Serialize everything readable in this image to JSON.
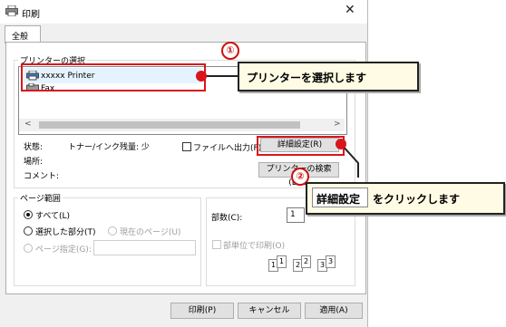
{
  "window": {
    "title": "印刷"
  },
  "tabs": [
    {
      "label": "全般"
    }
  ],
  "printer_group": {
    "label": "プリンターの選択",
    "printers": [
      {
        "name": "xxxxx Printer",
        "icon": "printer-icon"
      },
      {
        "name": "Fax",
        "icon": "fax-icon"
      }
    ]
  },
  "status": {
    "status_label": "状態:",
    "status_value": "トナー/インク残量: 少",
    "location_label": "場所:",
    "comment_label": "コメント:",
    "print_to_file": "ファイルへ出力(F)",
    "advanced_button": "詳細設定(R)",
    "find_printer_button": "プリンターの検索(D)..."
  },
  "page_range": {
    "label": "ページ範囲",
    "all": "すべて(L)",
    "selection": "選択した部分(T)",
    "current_page": "現在のページ(U)",
    "pages": "ページ指定(G):"
  },
  "copies": {
    "label": "部数(C):",
    "value": "1",
    "collate": "部単位で印刷(O)",
    "collate_pages": [
      "1",
      "1",
      "2",
      "2",
      "3",
      "3"
    ]
  },
  "footer": {
    "print": "印刷(P)",
    "cancel": "キャンセル",
    "apply": "適用(A)"
  },
  "annotations": {
    "step1_number": "①",
    "step1_text": "プリンターを選択します",
    "step2_number": "②",
    "step2_button": "詳細設定",
    "step2_text": "をクリックします"
  },
  "colors": {
    "accent_red": "#cc1111",
    "callout_fill": "#fffbe4",
    "selection": "#e5f3ff"
  }
}
